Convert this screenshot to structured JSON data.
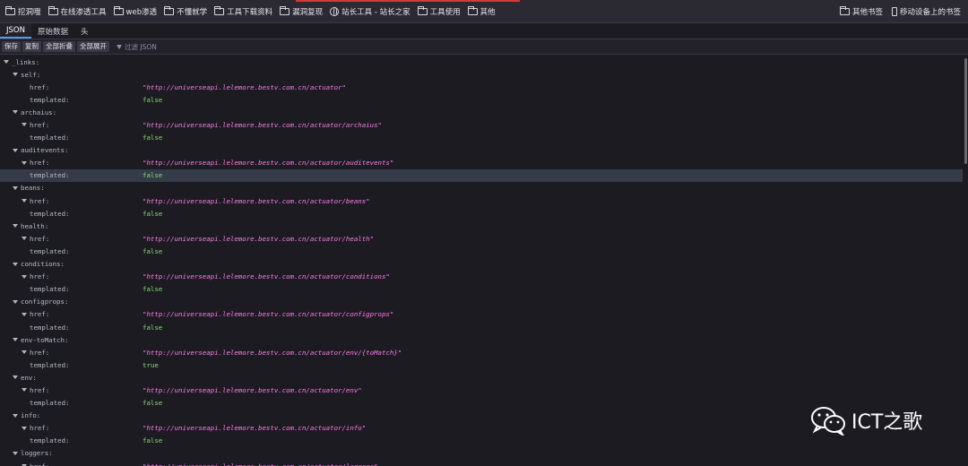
{
  "bookmarks": {
    "left": [
      {
        "label": "挖洞哦",
        "icon": "folder-icon"
      },
      {
        "label": "在线渗透工具",
        "icon": "folder-icon"
      },
      {
        "label": "web渗透",
        "icon": "folder-icon"
      },
      {
        "label": "不懂就学",
        "icon": "folder-icon"
      },
      {
        "label": "工具下载资料",
        "icon": "folder-icon"
      },
      {
        "label": "漏洞复现",
        "icon": "folder-icon"
      },
      {
        "label": "站长工具 - 站长之家",
        "icon": "globe-icon"
      },
      {
        "label": "工具使用",
        "icon": "folder-icon"
      },
      {
        "label": "其他",
        "icon": "folder-icon"
      }
    ],
    "right": [
      {
        "label": "其他书签",
        "icon": "folder-icon"
      },
      {
        "label": "移动设备上的书签",
        "icon": "mobile-icon"
      }
    ]
  },
  "tabs": [
    "JSON",
    "原始数据",
    "头"
  ],
  "toolbar": {
    "buttons": [
      "保存",
      "复制",
      "全部折叠",
      "全部展开"
    ],
    "filter_placeholder": "过滤 JSON"
  },
  "json_rows": [
    {
      "indent": 0,
      "key": "_links:",
      "twisty": true
    },
    {
      "indent": 1,
      "key": "self:",
      "twisty": true
    },
    {
      "indent": 2,
      "key": "href:",
      "value": "\"http://universeapi.lelemore.bestv.com.cn/actuator\"",
      "type": "str"
    },
    {
      "indent": 2,
      "key": "templated:",
      "value": "false",
      "type": "bool"
    },
    {
      "indent": 1,
      "key": "archaius:",
      "twisty": true
    },
    {
      "indent": 2,
      "key": "href:",
      "value": "\"http://universeapi.lelemore.bestv.com.cn/actuator/archaius\"",
      "type": "str",
      "twisty": true
    },
    {
      "indent": 2,
      "key": "templated:",
      "value": "false",
      "type": "bool"
    },
    {
      "indent": 1,
      "key": "auditevents:",
      "twisty": true
    },
    {
      "indent": 2,
      "key": "href:",
      "value": "\"http://universeapi.lelemore.bestv.com.cn/actuator/auditevents\"",
      "type": "str",
      "twisty": true
    },
    {
      "indent": 2,
      "key": "templated:",
      "value": "false",
      "type": "bool",
      "selected": true
    },
    {
      "indent": 1,
      "key": "beans:",
      "twisty": true
    },
    {
      "indent": 2,
      "key": "href:",
      "value": "\"http://universeapi.lelemore.bestv.com.cn/actuator/beans\"",
      "type": "str",
      "twisty": true
    },
    {
      "indent": 2,
      "key": "templated:",
      "value": "false",
      "type": "bool"
    },
    {
      "indent": 1,
      "key": "health:",
      "twisty": true
    },
    {
      "indent": 2,
      "key": "href:",
      "value": "\"http://universeapi.lelemore.bestv.com.cn/actuator/health\"",
      "type": "str",
      "twisty": true
    },
    {
      "indent": 2,
      "key": "templated:",
      "value": "false",
      "type": "bool"
    },
    {
      "indent": 1,
      "key": "conditions:",
      "twisty": true
    },
    {
      "indent": 2,
      "key": "href:",
      "value": "\"http://universeapi.lelemore.bestv.com.cn/actuator/conditions\"",
      "type": "str",
      "twisty": true
    },
    {
      "indent": 2,
      "key": "templated:",
      "value": "false",
      "type": "bool"
    },
    {
      "indent": 1,
      "key": "configprops:",
      "twisty": true
    },
    {
      "indent": 2,
      "key": "href:",
      "value": "\"http://universeapi.lelemore.bestv.com.cn/actuator/configprops\"",
      "type": "str",
      "twisty": true
    },
    {
      "indent": 2,
      "key": "templated:",
      "value": "false",
      "type": "bool"
    },
    {
      "indent": 1,
      "key": "env-toMatch:",
      "twisty": true
    },
    {
      "indent": 2,
      "key": "href:",
      "value": "\"http://universeapi.lelemore.bestv.com.cn/actuator/env/{toMatch}\"",
      "type": "str",
      "twisty": true
    },
    {
      "indent": 2,
      "key": "templated:",
      "value": "true",
      "type": "bool"
    },
    {
      "indent": 1,
      "key": "env:",
      "twisty": true
    },
    {
      "indent": 2,
      "key": "href:",
      "value": "\"http://universeapi.lelemore.bestv.com.cn/actuator/env\"",
      "type": "str",
      "twisty": true
    },
    {
      "indent": 2,
      "key": "templated:",
      "value": "false",
      "type": "bool"
    },
    {
      "indent": 1,
      "key": "info:",
      "twisty": true
    },
    {
      "indent": 2,
      "key": "href:",
      "value": "\"http://universeapi.lelemore.bestv.com.cn/actuator/info\"",
      "type": "str",
      "twisty": true
    },
    {
      "indent": 2,
      "key": "templated:",
      "value": "false",
      "type": "bool"
    },
    {
      "indent": 1,
      "key": "loggers:",
      "twisty": true
    },
    {
      "indent": 2,
      "key": "href:",
      "value": "\"http://universeapi.lelemore.bestv.com.cn/actuator/loggers\"",
      "type": "str",
      "twisty": true
    }
  ],
  "watermark": {
    "text": "ICT之歌",
    "icon": "wechat-icon"
  },
  "colors": {
    "string": "#ff7de9",
    "bool": "#86de74",
    "selected_row": "#353b48",
    "active_tab": "#45a1ff"
  }
}
